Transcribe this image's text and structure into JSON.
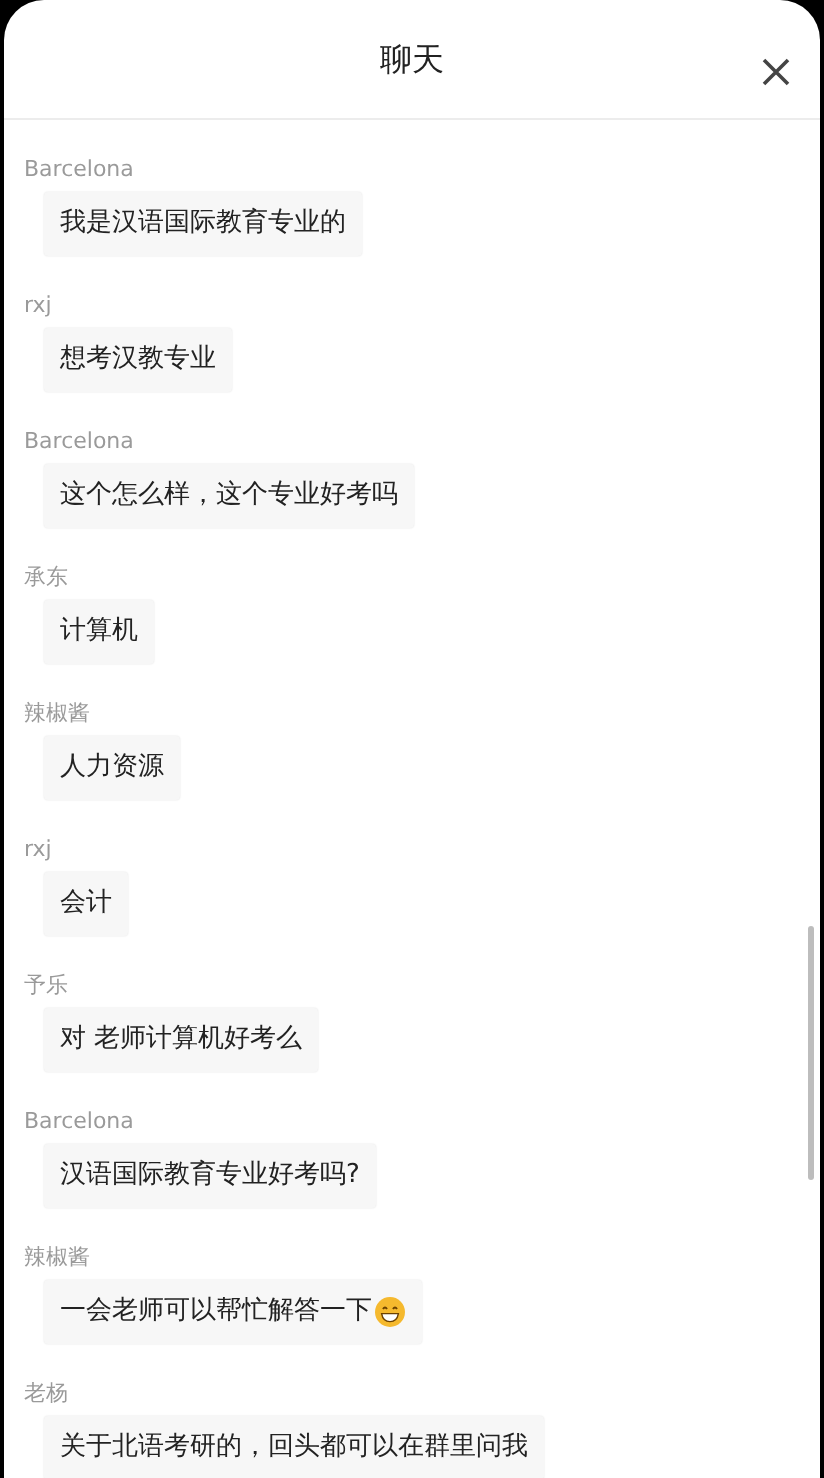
{
  "header": {
    "title": "聊天"
  },
  "messages": [
    {
      "sender": "Barcelona",
      "text": "我是汉语国际教育专业的",
      "emoji": false
    },
    {
      "sender": "rxj",
      "text": "想考汉教专业",
      "emoji": false
    },
    {
      "sender": "Barcelona",
      "text": "这个怎么样，这个专业好考吗",
      "emoji": false
    },
    {
      "sender": "承东",
      "text": "计算机",
      "emoji": false
    },
    {
      "sender": "辣椒酱",
      "text": "人力资源",
      "emoji": false
    },
    {
      "sender": "rxj",
      "text": "会计",
      "emoji": false
    },
    {
      "sender": "予乐",
      "text": "对 老师计算机好考么",
      "emoji": false
    },
    {
      "sender": "Barcelona",
      "text": "汉语国际教育专业好考吗?",
      "emoji": false
    },
    {
      "sender": "辣椒酱",
      "text": "一会老师可以帮忙解答一下",
      "emoji": true
    },
    {
      "sender": "老杨",
      "text": "关于北语考研的，回头都可以在群里问我",
      "emoji": false
    }
  ]
}
